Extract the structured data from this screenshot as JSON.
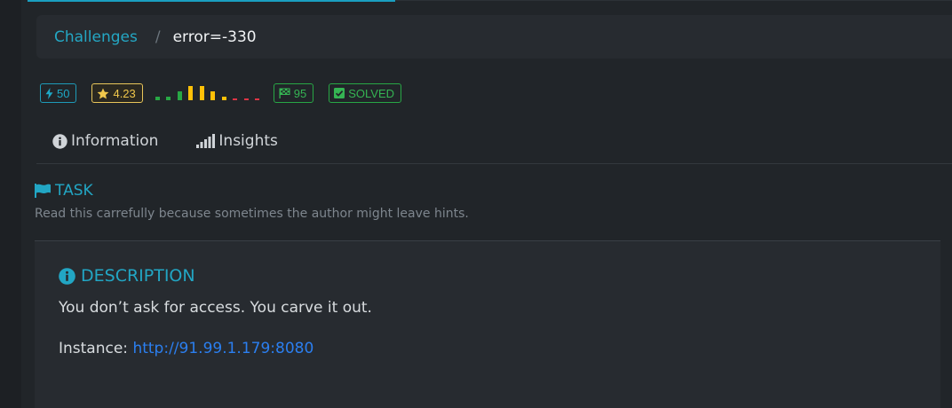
{
  "breadcrumb": {
    "parent": "Challenges",
    "separator": "/",
    "current": "error=-330"
  },
  "badges": {
    "points": "50",
    "rating": "4.23",
    "solves": "95",
    "solved": "SOLVED"
  },
  "difficulty_bars": [
    {
      "level": 0.22,
      "color": "#28a745"
    },
    {
      "level": 0.22,
      "color": "#28a745"
    },
    {
      "level": 0.6,
      "color": "#28a745"
    },
    {
      "level": 0.95,
      "color": "#ffc107"
    },
    {
      "level": 0.95,
      "color": "#ffc107"
    },
    {
      "level": 0.6,
      "color": "#ffc107"
    },
    {
      "level": 0.22,
      "color": "#ffc107"
    },
    {
      "level": 0.1,
      "color": "#dc3545"
    },
    {
      "level": 0.1,
      "color": "#dc3545"
    },
    {
      "level": 0.1,
      "color": "#dc3545"
    }
  ],
  "tabs": {
    "information": "Information",
    "insights": "Insights"
  },
  "task": {
    "title": "TASK",
    "subtitle": "Read this carrefully because sometimes the author might leave hints."
  },
  "description": {
    "title": "DESCRIPTION",
    "text": "You don’t ask for access. You carve it out.",
    "instance_label": "Instance: ",
    "instance_url": "http://91.99.1.179:8080"
  },
  "colors": {
    "accent": "#22a6c4",
    "link": "#2b7ff0",
    "success": "#28a745",
    "warning": "#ffc107",
    "danger": "#dc3545",
    "background": "#212529",
    "panel": "#272b30"
  },
  "icons": {
    "points": "bolt-icon",
    "rating": "star-icon",
    "solves": "flag-checkered-icon",
    "solved": "check-square-icon",
    "information_tab": "info-circle-icon",
    "insights_tab": "signal-bars-icon",
    "task": "flag-icon",
    "description": "info-circle-icon"
  }
}
